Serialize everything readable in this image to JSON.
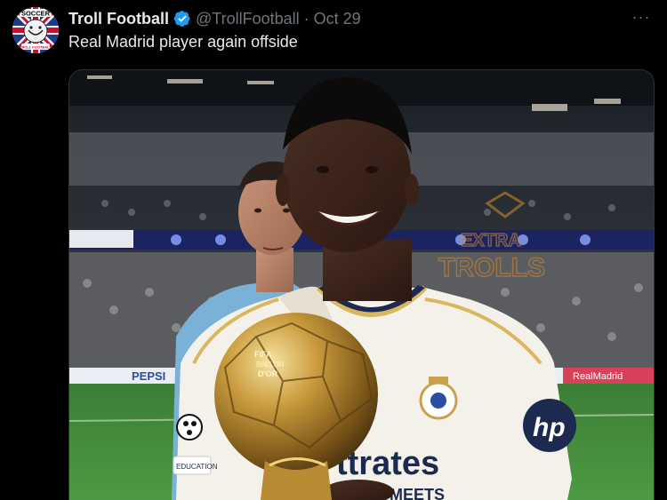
{
  "tweet": {
    "display_name": "Troll Football",
    "handle": "@TrollFootball",
    "separator": "·",
    "date": "Oct 29",
    "text": "Real Madrid player again offside",
    "more_label": "···"
  },
  "avatar": {
    "logo_text_top": "SOCCER",
    "logo_text_bottom": "TROLL FOOTBALL"
  },
  "media": {
    "watermark_line1": "EXTRA",
    "watermark_line2": "TROLLS",
    "trophy_text_1": "FIFA",
    "trophy_text_2": "BALLON",
    "trophy_text_3": "D'OR",
    "shirt_text": "ttrates",
    "shirt_text_2": "MEETS",
    "sleeve_text": "hp",
    "badge_text": "EDUCATION",
    "ad_board_left": "PEPSI",
    "ad_board_right": "RealMadrid"
  },
  "colors": {
    "verified": "#1d9bf0",
    "pitch": "#3f8a3a",
    "shirt": "#f4f1ea",
    "trim": "#d9b75e"
  }
}
